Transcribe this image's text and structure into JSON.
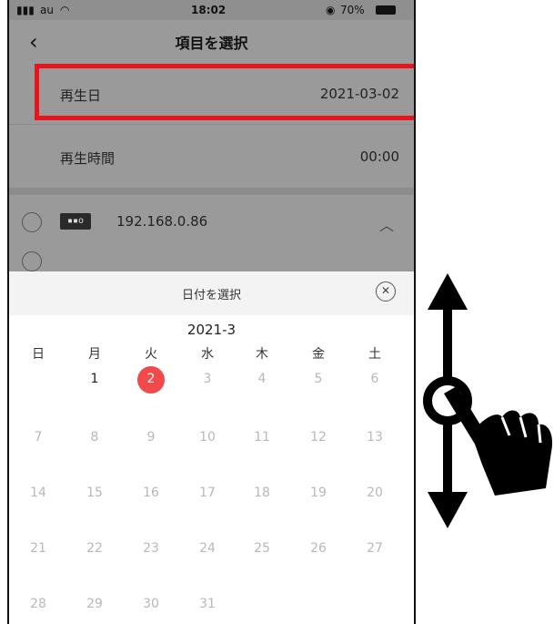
{
  "status_bar": {
    "carrier": "au",
    "time": "18:02",
    "battery": "70%"
  },
  "nav": {
    "title": "項目を選択"
  },
  "rows": {
    "playback_date": {
      "label": "再生日",
      "value": "2021-03-02"
    },
    "playback_time": {
      "label": "再生時間",
      "value": "00:00"
    },
    "device": {
      "icon_text": "▪▪o",
      "ip": "192.168.0.86"
    }
  },
  "date_picker": {
    "title": "日付を選択",
    "month_label": "2021-3",
    "weekdays": [
      "日",
      "月",
      "火",
      "水",
      "木",
      "金",
      "土"
    ],
    "selected_day": "2",
    "weeks": [
      [
        "",
        "1",
        "2",
        "3",
        "4",
        "5",
        "6"
      ],
      [
        "7",
        "8",
        "9",
        "10",
        "11",
        "12",
        "13"
      ],
      [
        "14",
        "15",
        "16",
        "17",
        "18",
        "19",
        "20"
      ],
      [
        "21",
        "22",
        "23",
        "24",
        "25",
        "26",
        "27"
      ],
      [
        "28",
        "29",
        "30",
        "31",
        "",
        "",
        ""
      ]
    ]
  },
  "colors": {
    "highlight_border": "#e8141b",
    "selected_day_bg": "#f04a4a",
    "dim_overlay": "#9a9a9a"
  }
}
